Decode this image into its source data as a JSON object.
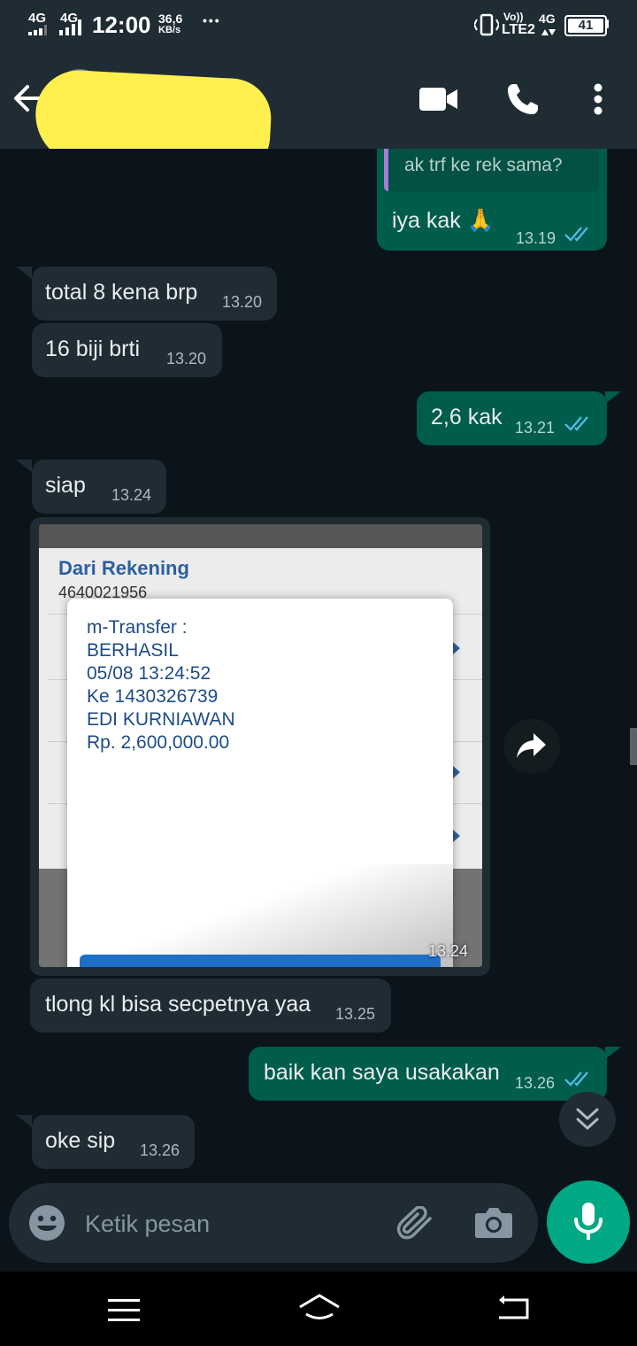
{
  "status_bar": {
    "signal1": "4G",
    "signal2": "4G",
    "time": "12:00",
    "speed_value": "36,6",
    "speed_unit": "KB/s",
    "more": "•••",
    "volte": "Vo))",
    "lte": "LTE2",
    "net4g": "4G",
    "battery": "41"
  },
  "header": {
    "contact_name": ""
  },
  "messages": [
    {
      "quote": "ak trf ke rek sama?",
      "text": "iya kak 🙏",
      "time": "13.19",
      "direction": "out"
    },
    {
      "text": "total 8 kena brp",
      "time": "13.20",
      "direction": "in"
    },
    {
      "text": "16 biji brti",
      "time": "13.20",
      "direction": "in"
    },
    {
      "text": "2,6 kak",
      "time": "13.21",
      "direction": "out"
    },
    {
      "text": "siap",
      "time": "13.24",
      "direction": "in"
    },
    {
      "text": "tlong kl bisa secpetnya yaa",
      "time": "13.25",
      "direction": "in"
    },
    {
      "text": "baik kan saya usakakan",
      "time": "13.26",
      "direction": "out"
    },
    {
      "text": "oke sip",
      "time": "13.26",
      "direction": "in"
    }
  ],
  "image_message": {
    "time": "13.24",
    "bank_label": "Dari Rekening",
    "bank_account": "4640021956",
    "receipt_lines": [
      "m-Transfer :",
      "BERHASIL",
      "05/08 13:24:52",
      "Ke 1430326739",
      "EDI KURNIAWAN",
      "Rp. 2,600,000.00"
    ]
  },
  "composer": {
    "placeholder": "Ketik pesan"
  },
  "colors": {
    "header_bg": "#1f2c34",
    "chat_bg": "#0b141a",
    "incoming_bubble": "#1f2c34",
    "outgoing_bubble": "#005c4b",
    "accent": "#00a884",
    "read_ticks": "#53bdeb"
  },
  "icons": [
    "back-arrow-icon",
    "video-call-icon",
    "phone-icon",
    "more-vert-icon",
    "emoji-icon",
    "attach-icon",
    "camera-icon",
    "mic-icon",
    "forward-icon",
    "scroll-down-icon",
    "nav-menu-icon",
    "nav-home-icon",
    "nav-back-icon"
  ]
}
